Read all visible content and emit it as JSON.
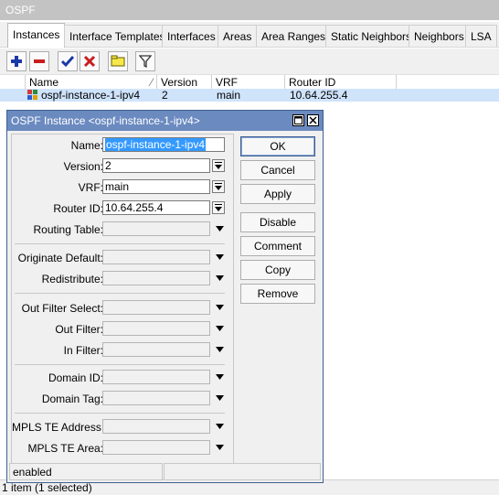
{
  "window": {
    "title": "OSPF"
  },
  "tabs": [
    "Instances",
    "Interface Templates",
    "Interfaces",
    "Areas",
    "Area Ranges",
    "Static Neighbors",
    "Neighbors",
    "LSA"
  ],
  "table": {
    "columns": [
      "Name",
      "Version",
      "VRF",
      "Router ID"
    ],
    "rows": [
      {
        "name": "ospf-instance-1-ipv4",
        "version": "2",
        "vrf": "main",
        "router_id": "10.64.255.4"
      }
    ]
  },
  "status": {
    "count_text": "1 item (1 selected)"
  },
  "dialog": {
    "title": "OSPF Instance <ospf-instance-1-ipv4>",
    "fields": {
      "name_label": "Name:",
      "name_value": "ospf-instance-1-ipv4",
      "version_label": "Version:",
      "version_value": "2",
      "vrf_label": "VRF:",
      "vrf_value": "main",
      "router_id_label": "Router ID:",
      "router_id_value": "10.64.255.4",
      "routing_table_label": "Routing Table:",
      "originate_default_label": "Originate Default:",
      "redistribute_label": "Redistribute:",
      "out_filter_select_label": "Out Filter Select:",
      "out_filter_label": "Out Filter:",
      "in_filter_label": "In Filter:",
      "domain_id_label": "Domain ID:",
      "domain_tag_label": "Domain Tag:",
      "mpls_te_address_label": "MPLS TE Address:",
      "mpls_te_area_label": "MPLS TE Area:"
    },
    "buttons": {
      "ok": "OK",
      "cancel": "Cancel",
      "apply": "Apply",
      "disable": "Disable",
      "comment": "Comment",
      "copy": "Copy",
      "remove": "Remove"
    },
    "status": "enabled"
  },
  "colors": {
    "accent": "#6b8ac0",
    "selection": "#cfe3fb"
  }
}
